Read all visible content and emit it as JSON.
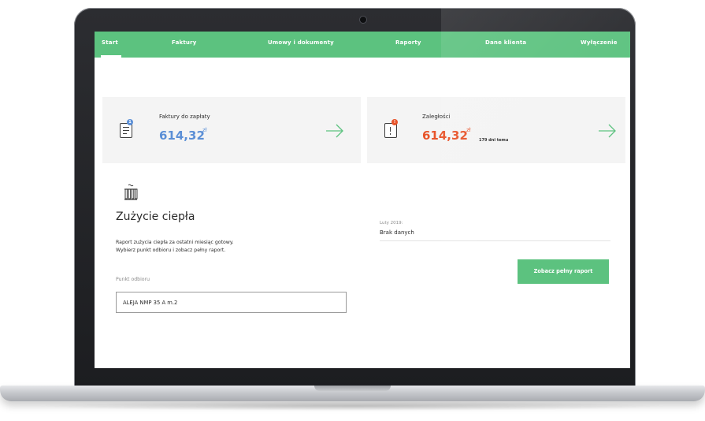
{
  "nav": {
    "items": [
      "Start",
      "Faktury",
      "Umowy i dokumenty",
      "Raporty",
      "Dane klienta",
      "Wyłączenie"
    ],
    "active": "Start",
    "color": "#5cc27f"
  },
  "cards": {
    "invoices": {
      "label": "Faktury do zapłaty",
      "amount": "614,32",
      "currency": "zł",
      "amount_color": "#5b8fd6",
      "badge_color": "#5b8fd6",
      "icon": "document-icon"
    },
    "arrears": {
      "label": "Zaległości",
      "amount": "614,32",
      "currency": "zł",
      "days": "179 dni temu",
      "amount_color": "#e8542a",
      "badge_color": "#e8542a",
      "icon": "document-alert-icon"
    }
  },
  "heat": {
    "icon": "radiator-icon",
    "title": "Zużycie ciepła",
    "description": [
      "Raport zużycia ciepła za ostatni miesiąc gotowy.",
      "Wybierz punkt odbioru i zobacz pełny raport."
    ],
    "field_label": "Punkt odbioru",
    "field_value": "ALEJA NMP 35 A m.2",
    "period": "Luty 2019:",
    "no_data": "Brak danych",
    "report_button": "Zobacz pełny raport"
  }
}
